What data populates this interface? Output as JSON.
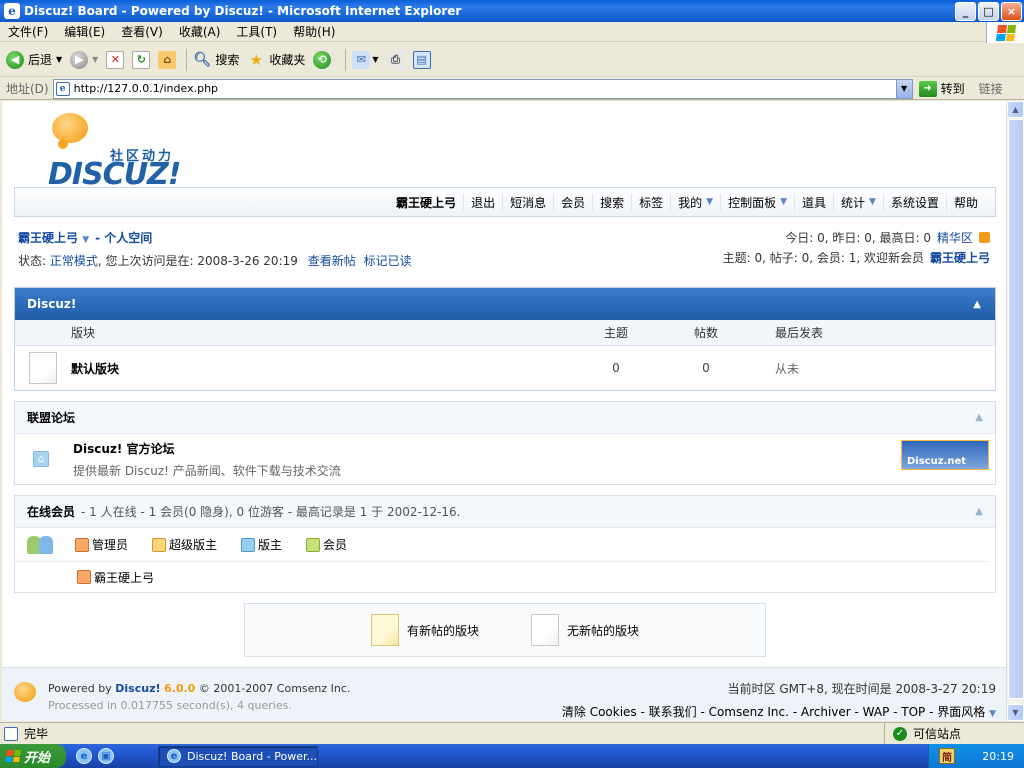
{
  "window": {
    "title": "Discuz! Board - Powered by Discuz! - Microsoft Internet Explorer",
    "buttons": {
      "minimize": "_",
      "maximize": "□",
      "close": "×"
    }
  },
  "menu": [
    "文件(F)",
    "编辑(E)",
    "查看(V)",
    "收藏(A)",
    "工具(T)",
    "帮助(H)"
  ],
  "toolbar": {
    "back": "后退",
    "search": "搜索",
    "favorites": "收藏夹"
  },
  "address": {
    "label": "地址(D)",
    "url": "http://127.0.0.1/index.php",
    "go": "转到",
    "links": "链接"
  },
  "site": {
    "slogan": "社区动力",
    "brand": "DISCUZ!",
    "nav": [
      "霸王硬上弓",
      "退出",
      "短消息",
      "会员",
      "搜索",
      "标签",
      "我的",
      "控制面板",
      "道具",
      "统计",
      "系统设置",
      "帮助"
    ],
    "user": {
      "name": "霸王硬上弓",
      "space": "- 个人空间",
      "status_label": "状态:",
      "mode": "正常模式",
      "last_visit": ", 您上次访问是在: 2008-3-26 20:19",
      "new_posts": "查看新帖",
      "mark_read": "标记已读"
    },
    "stats": {
      "line1": "今日: 0, 昨日: 0, 最高日: 0",
      "digest": "精华区",
      "line2": "主题: 0, 帖子: 0, 会员: 1, 欢迎新会员",
      "newest": "霸王硬上弓"
    }
  },
  "forum": {
    "category": "Discuz!",
    "columns": {
      "forum": "版块",
      "threads": "主题",
      "posts": "帖数",
      "last": "最后发表"
    },
    "rows": [
      {
        "name": "默认版块",
        "threads": "0",
        "posts": "0",
        "last": "从未"
      }
    ]
  },
  "alliance": {
    "title": "联盟论坛",
    "name": "Discuz! 官方论坛",
    "desc": "提供最新 Discuz! 产品新闻、软件下载与技术交流",
    "logo_text": "Discuz.net"
  },
  "online": {
    "title": "在线会员",
    "summary": "- 1 人在线 - 1 会员(0 隐身), 0 位游客 - 最高记录是 1 于 2002-12-16.",
    "legend": [
      "管理员",
      "超级版主",
      "版主",
      "会员"
    ],
    "users": [
      "霸王硬上弓"
    ]
  },
  "icon_legend": {
    "new": "有新帖的版块",
    "none": "无新帖的版块"
  },
  "footer": {
    "powered": "Powered by",
    "product": "Discuz!",
    "version": "6.0.0",
    "copyright": "© 2001-2007 Comsenz Inc.",
    "processed": "Processed in 0.017755 second(s), 4 queries.",
    "timezone": "当前时区  GMT+8, 现在时间是  2008-3-27 20:19",
    "links": "清除 Cookies - 联系我们 - Comsenz Inc. - Archiver - WAP - TOP - 界面风格"
  },
  "status": {
    "text": "完毕",
    "zone": "可信站点"
  },
  "taskbar": {
    "start": "开始",
    "task": "Discuz! Board - Power...",
    "clock": "20:19",
    "ime": "简"
  }
}
